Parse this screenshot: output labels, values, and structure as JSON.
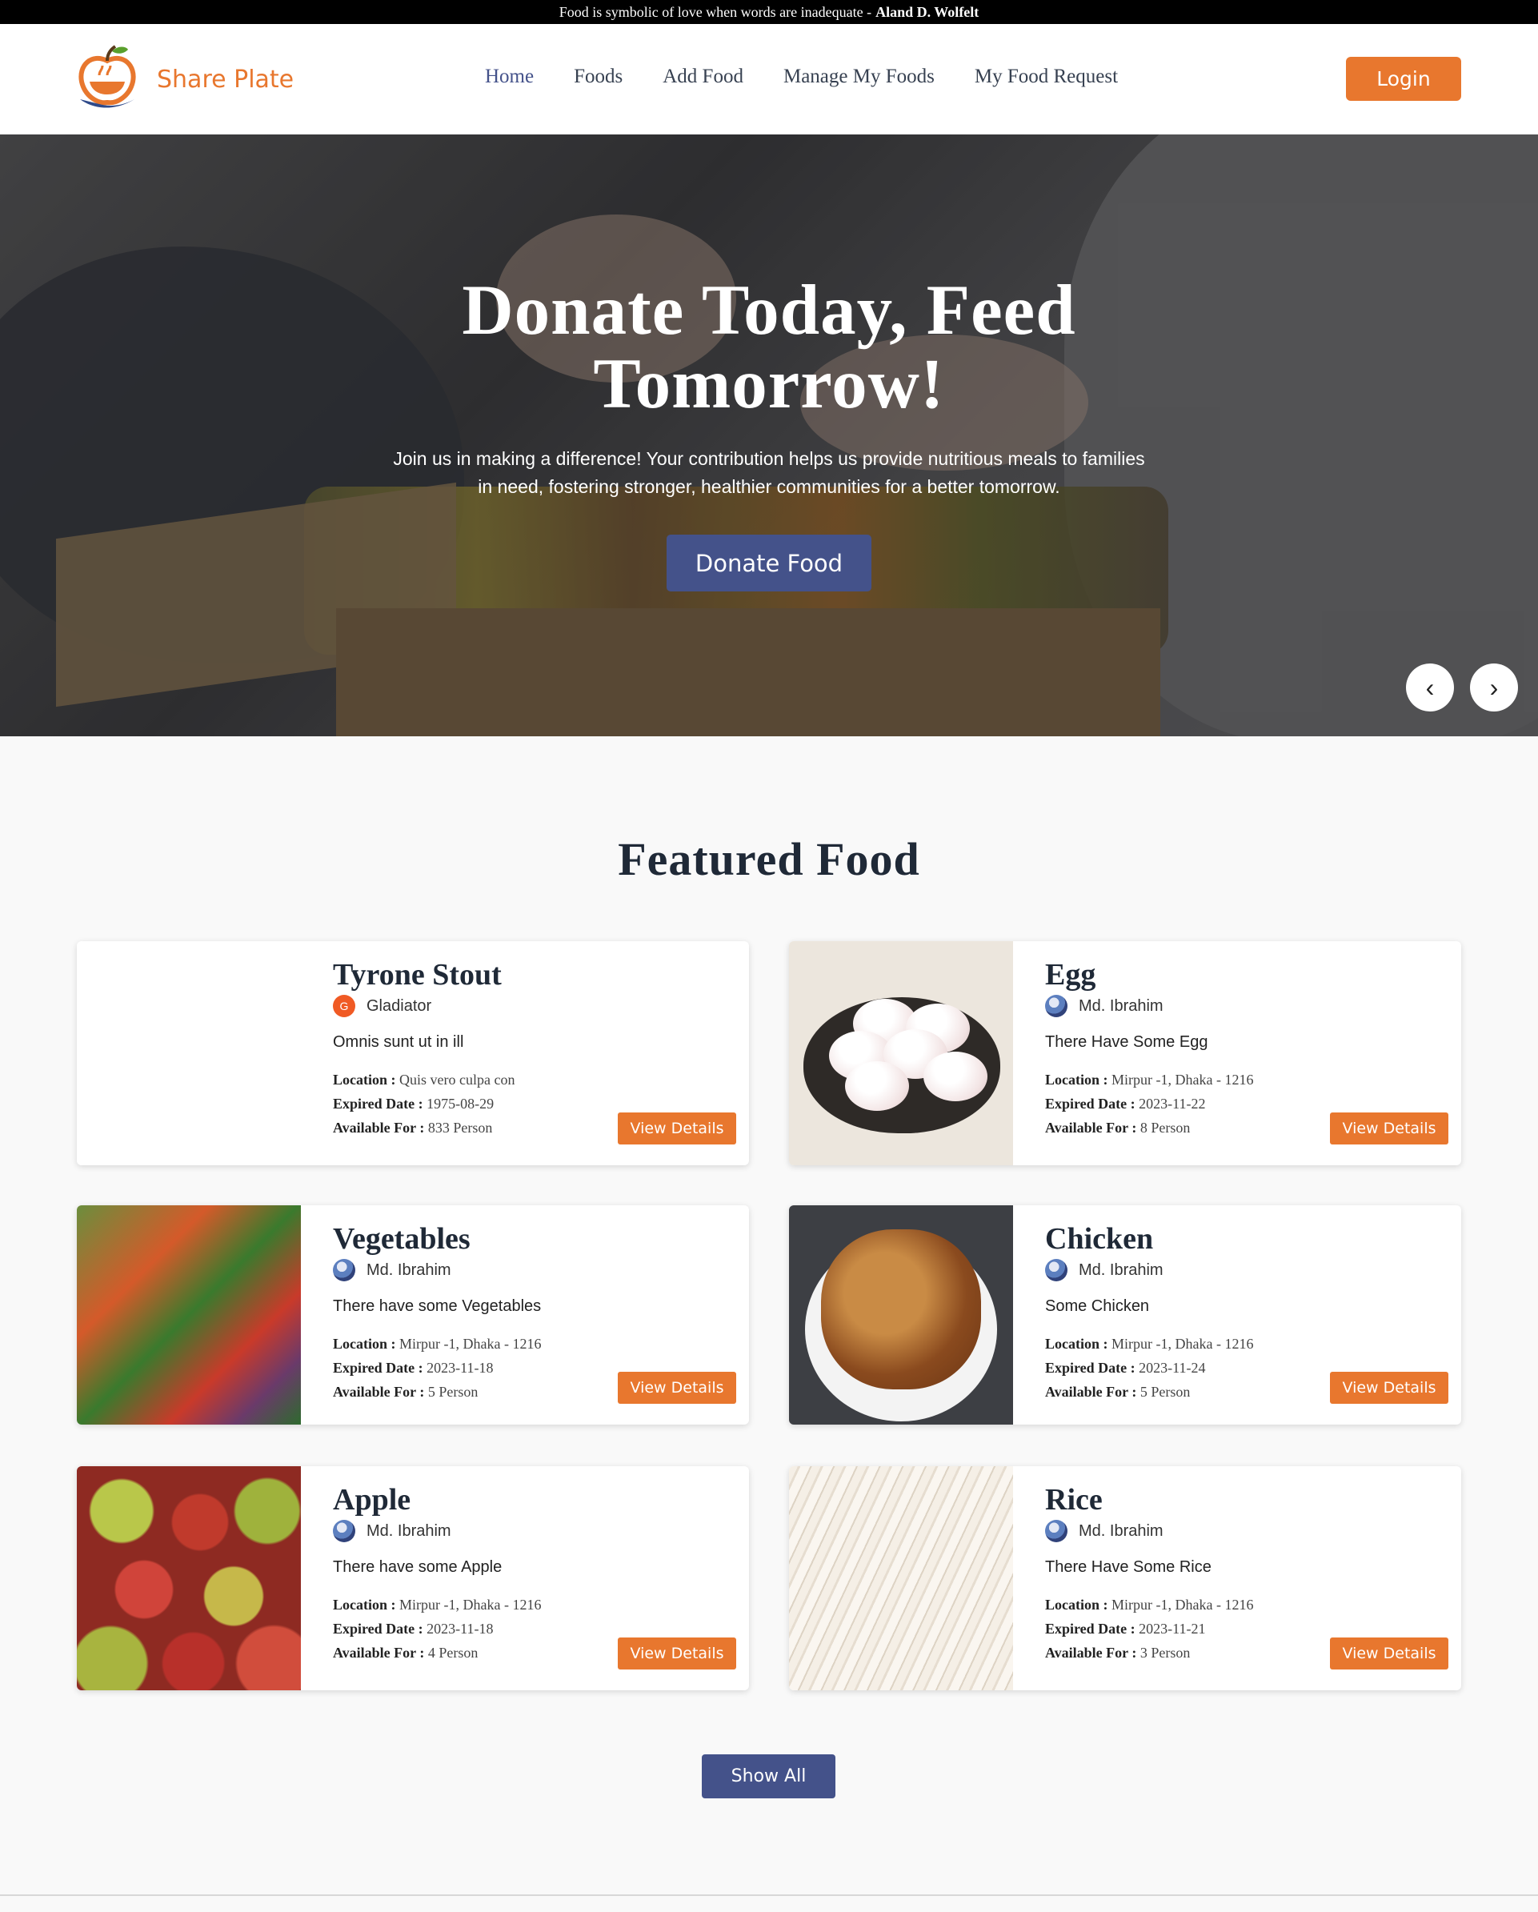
{
  "topbar": {
    "quote": "Food is symbolic of love when words are inadequate -",
    "author": "Aland D. Wolfelt"
  },
  "brand": {
    "name": "Share Plate"
  },
  "nav": {
    "items": [
      {
        "label": "Home",
        "active": true
      },
      {
        "label": "Foods"
      },
      {
        "label": "Add Food"
      },
      {
        "label": "Manage My Foods"
      },
      {
        "label": "My Food Request"
      }
    ],
    "login_label": "Login"
  },
  "hero": {
    "title": "Donate Today, Feed Tomorrow!",
    "subtitle": "Join us in making a difference! Your contribution helps us provide nutritious meals to families in need, fostering stronger, healthier communities for a better tomorrow.",
    "cta_label": "Donate Food",
    "prev_icon": "‹",
    "next_icon": "›"
  },
  "featured": {
    "title": "Featured Food",
    "labels": {
      "location": "Location :",
      "expired": "Expired Date :",
      "available": "Available For :"
    },
    "view_label": "View Details",
    "cards": [
      {
        "name": "Tyrone Stout",
        "donor": "Gladiator",
        "avatar_letter": "G",
        "description": "Omnis sunt ut in ill",
        "location": "Quis vero culpa con",
        "expired": "1975-08-29",
        "available": "833 Person"
      },
      {
        "name": "Egg",
        "donor": "Md. Ibrahim",
        "description": "There Have Some Egg",
        "location": "Mirpur -1, Dhaka - 1216",
        "expired": "2023-11-22",
        "available": "8 Person"
      },
      {
        "name": "Vegetables",
        "donor": "Md. Ibrahim",
        "description": "There have some Vegetables",
        "location": "Mirpur -1, Dhaka - 1216",
        "expired": "2023-11-18",
        "available": "5 Person"
      },
      {
        "name": "Chicken",
        "donor": "Md. Ibrahim",
        "description": "Some Chicken",
        "location": "Mirpur -1, Dhaka - 1216",
        "expired": "2023-11-24",
        "available": "5 Person"
      },
      {
        "name": "Apple",
        "donor": "Md. Ibrahim",
        "description": "There have some Apple",
        "location": "Mirpur -1, Dhaka - 1216",
        "expired": "2023-11-18",
        "available": "4 Person"
      },
      {
        "name": "Rice",
        "donor": "Md. Ibrahim",
        "description": "There Have Some Rice",
        "location": "Mirpur -1, Dhaka - 1216",
        "expired": "2023-11-21",
        "available": "3 Person"
      }
    ],
    "show_all_label": "Show All"
  },
  "colors": {
    "accent": "#e8772e",
    "primary": "#44528a",
    "text": "#1f2937"
  }
}
